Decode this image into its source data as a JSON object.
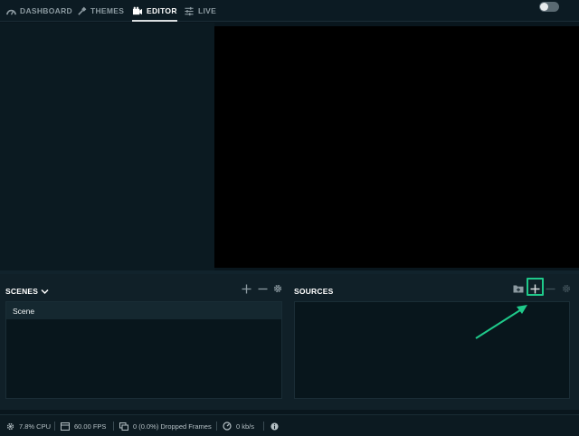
{
  "nav": {
    "dashboard": "DASHBOARD",
    "themes": "THEMES",
    "editor": "EDITOR",
    "live": "LIVE"
  },
  "scenes": {
    "title": "SCENES",
    "items": [
      "Scene"
    ]
  },
  "sources": {
    "title": "SOURCES",
    "items": []
  },
  "status": {
    "cpu": "7.8% CPU",
    "fps": "60.00 FPS",
    "dropped": "0 (0.0%) Dropped Frames",
    "bitrate": "0 kb/s"
  },
  "colors": {
    "background": "#09161d",
    "panel": "#102028",
    "preview": "#000000",
    "highlight": "#1fc98a",
    "active_text": "#ffffff",
    "inactive_text": "#8c9aa1"
  },
  "icons": {
    "dashboard": "dashboard-icon",
    "themes": "themes-icon",
    "editor": "editor-icon",
    "live": "live-icon",
    "add": "plus-icon",
    "remove": "minus-icon",
    "settings": "gear-icon",
    "folder": "folder-add-icon",
    "cpu": "cpu-icon",
    "fps": "fps-icon",
    "dropped": "dropped-frames-icon",
    "bitrate": "bitrate-icon",
    "info": "info-icon"
  }
}
